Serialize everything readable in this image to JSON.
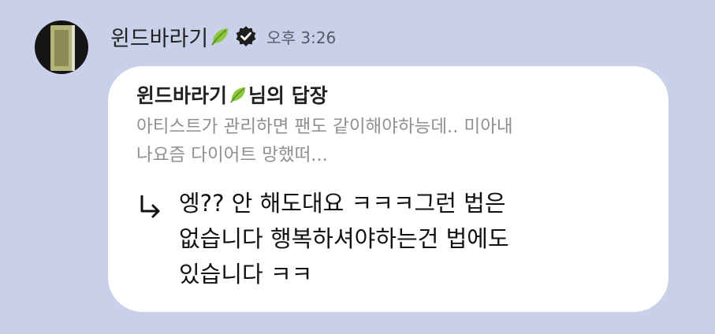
{
  "sender": {
    "name": "윈드바라기",
    "badge_icon": "leaf-icon",
    "verified_icon": "verified-badge-icon",
    "timestamp": "오후 3:26"
  },
  "reply": {
    "target_name": "윈드바라기",
    "title_suffix": "님의 답장",
    "quoted_text": "아티스트가 관리하면 팬도 같이해야하능데.. 미아내\n나요즘 다이어트 망했떠...",
    "message_text": "엥?? 안 해도대요 ㅋㅋㅋ그런 법은\n없습니다 행복하셔야하는건 법에도\n있습니다 ㅋㅋ",
    "arrow_icon": "reply-arrow-icon"
  },
  "colors": {
    "background": "#c9d1ea",
    "bubble": "#ffffff",
    "quoted_text": "#8f8f8f",
    "leaf": "#8cc63f"
  }
}
